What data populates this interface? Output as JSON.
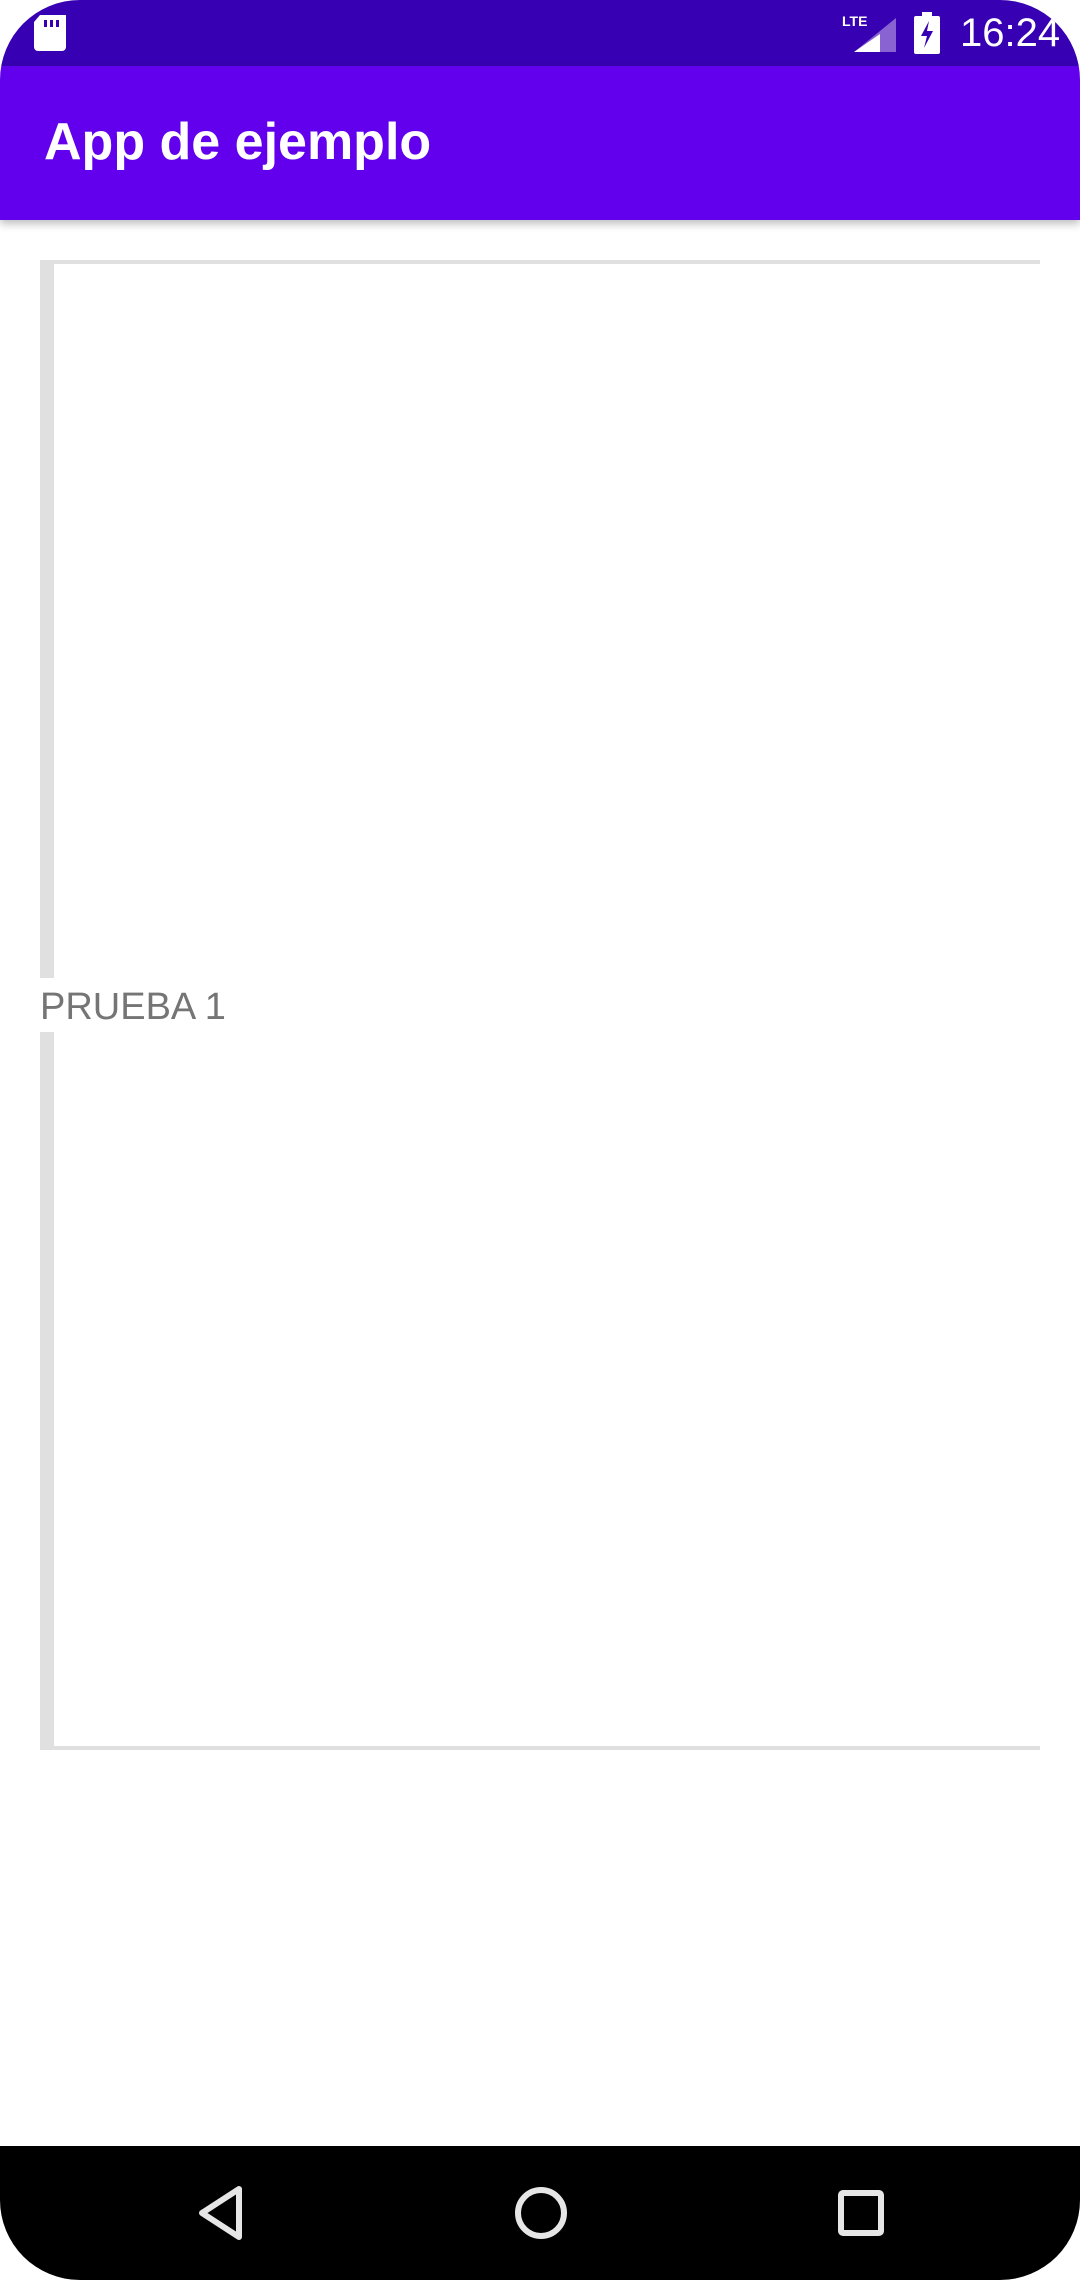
{
  "status_bar": {
    "time": "16:24",
    "network_label": "LTE",
    "icons": [
      "sd-card-icon",
      "lte-signal-icon",
      "battery-charging-icon"
    ],
    "background_color": "#3700B3"
  },
  "app_bar": {
    "title": "App de ejemplo",
    "background_color": "#6200EE"
  },
  "content": {
    "section_label": "PRUEBA 1",
    "divider_color": "#e0e0e0"
  },
  "nav_bar": {
    "buttons": [
      "back-icon",
      "home-icon",
      "recents-icon"
    ],
    "background_color": "#000000"
  }
}
